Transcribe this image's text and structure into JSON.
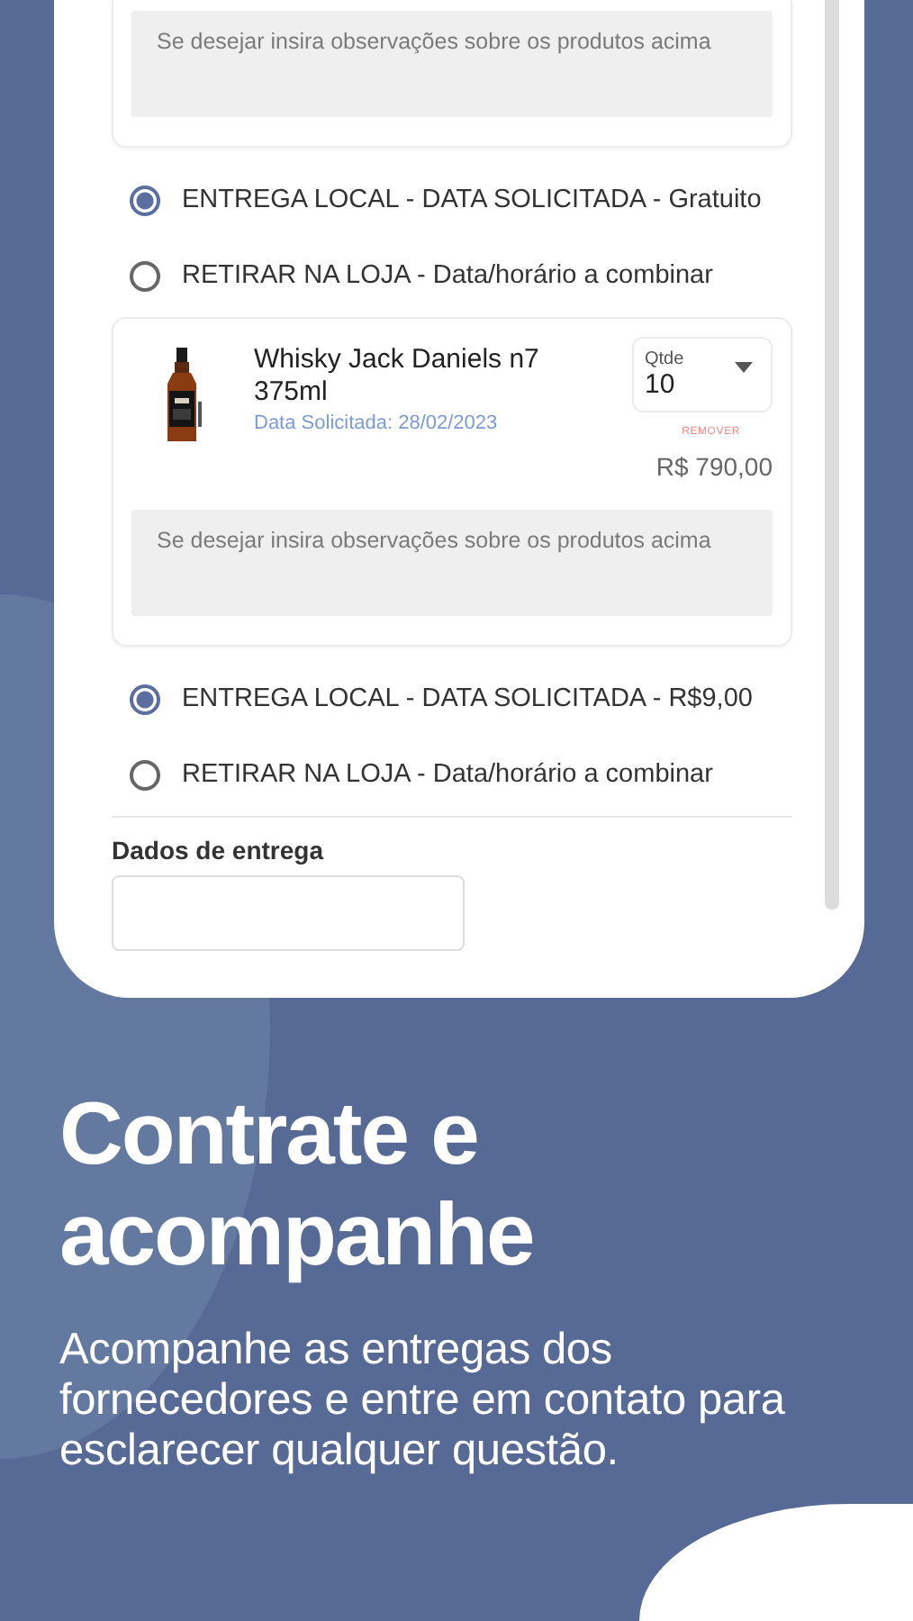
{
  "order_groups": [
    {
      "observation": {
        "placeholder": "Se desejar insira observações sobre os produtos acima"
      },
      "delivery_options": [
        {
          "label": "ENTREGA LOCAL - DATA SOLICITADA - Gratuito",
          "selected": true
        },
        {
          "label": "RETIRAR NA LOJA - Data/horário a combinar",
          "selected": false
        }
      ]
    },
    {
      "product": {
        "name": "Whisky Jack Daniels n7 375ml",
        "requested_date": "Data Solicitada: 28/02/2023",
        "quantity_label": "Qtde",
        "quantity": "10",
        "remove": "REMOVER",
        "price": "R$ 790,00"
      },
      "observation": {
        "placeholder": "Se desejar insira observações sobre os produtos acima"
      },
      "delivery_options": [
        {
          "label": "ENTREGA LOCAL - DATA SOLICITADA - R$9,00",
          "selected": true
        },
        {
          "label": "RETIRAR NA LOJA - Data/horário a combinar",
          "selected": false
        }
      ]
    }
  ],
  "delivery_data": {
    "title": "Dados de entrega"
  },
  "headline": "Contrate e acompanhe",
  "description": "Acompanhe as entregas dos fornecedores e entre em contato para esclarecer qualquer questão."
}
